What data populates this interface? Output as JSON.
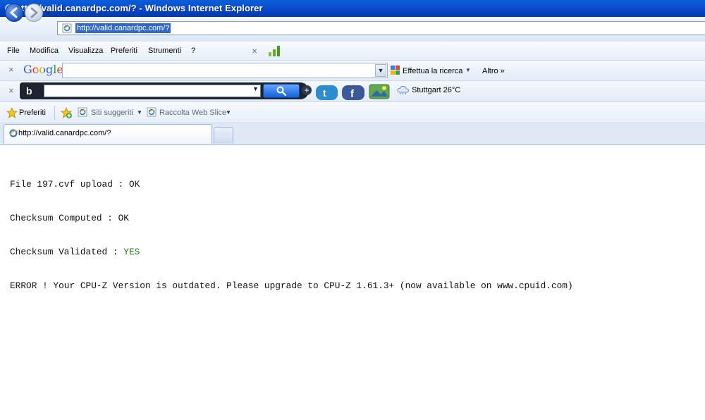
{
  "window": {
    "title": "http://valid.canardpc.com/? - Windows Internet Explorer"
  },
  "navigation": {
    "address_url": "http://valid.canardpc.com/?"
  },
  "menu": {
    "items": [
      "File",
      "Modifica",
      "Visualizza",
      "Preferiti",
      "Strumenti",
      "?"
    ]
  },
  "google_toolbar": {
    "logo": "Google",
    "search_label": "Effettua la ricerca",
    "more_label": "Altro »"
  },
  "bing_toolbar": {
    "logo": "b",
    "weather": "Stuttgart 26°C"
  },
  "favorites_bar": {
    "favorites_label": "Preferiti",
    "suggested_sites": "Siti suggeriti",
    "web_slice": "Raccolta Web Slice"
  },
  "tabs": [
    {
      "label": "http://valid.canardpc.com/?"
    }
  ],
  "content": {
    "lines": [
      {
        "text": "File 197.cvf upload : ",
        "status": "OK"
      },
      {
        "text": "Checksum Computed : ",
        "status": "OK"
      },
      {
        "text": "Checksum Validated : ",
        "status": "YES"
      },
      {
        "text": "ERROR ! Your CPU-Z Version is outdated. Please upgrade to CPU-Z 1.61.3+ (now available on www.cpuid.com)",
        "status": ""
      }
    ]
  },
  "colors": {
    "title_bar": "#0041c2",
    "status_yes": "#1a7a16"
  }
}
